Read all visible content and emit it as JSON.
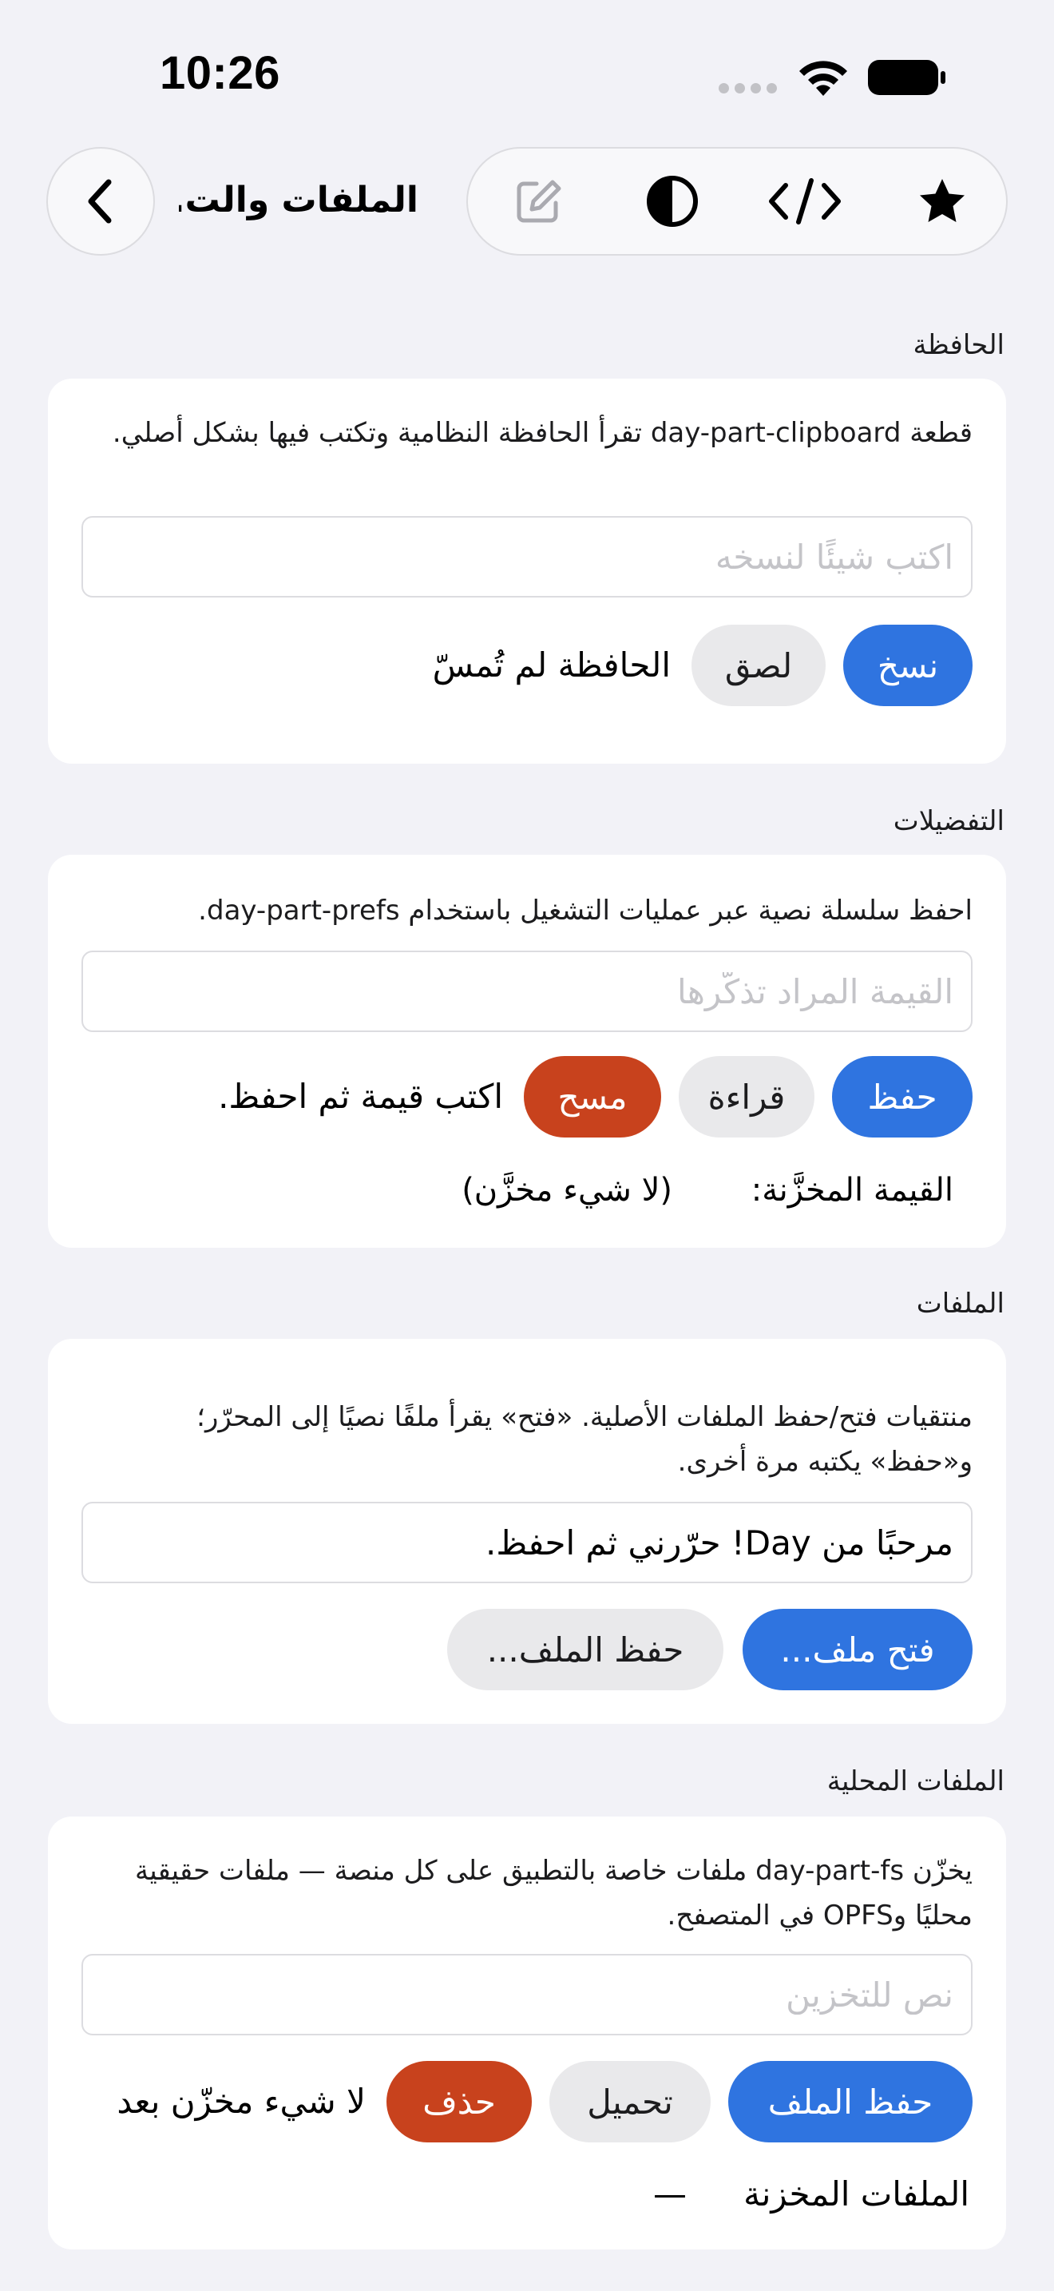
{
  "status_bar": {
    "time": "10:26"
  },
  "nav": {
    "title": "الملفات والت...",
    "icons": [
      "chevron-left-icon",
      "compose-icon",
      "contrast-icon",
      "code-icon",
      "star-icon"
    ]
  },
  "clipboard": {
    "section_label": "الحافظة",
    "description": "قطعة day-part-clipboard تقرأ الحافظة النظامية وتكتب فيها بشكل أصلي.",
    "input_placeholder": "اكتب شيئًا لنسخه",
    "copy_label": "نسخ",
    "paste_label": "لصق",
    "status": "الحافظة لم تُمسّ"
  },
  "prefs": {
    "section_label": "التفضيلات",
    "description": "احفظ سلسلة نصية عبر عمليات التشغيل باستخدام day-part-prefs.",
    "input_placeholder": "القيمة المراد تذكّرها",
    "save_label": "حفظ",
    "read_label": "قراءة",
    "clear_label": "مسح",
    "status": "اكتب قيمة ثم احفظ.",
    "stored_label": "القيمة المخزَّنة:",
    "stored_value": "(لا شيء مخزَّن)"
  },
  "files": {
    "section_label": "الملفات",
    "description": "منتقيات فتح/حفظ الملفات الأصلية. «فتح» يقرأ ملفًا نصيًا إلى المحرّر؛ و«حفظ» يكتبه مرة أخرى.",
    "editor_value": "مرحبًا من Day! حرّرني ثم احفظ.",
    "open_label": "فتح ملف...",
    "save_label": "حفظ الملف..."
  },
  "local_files": {
    "section_label": "الملفات المحلية",
    "description": "يخزّن day-part-fs ملفات خاصة بالتطبيق على كل منصة — ملفات حقيقية محليًا وOPFS في المتصفح.",
    "input_placeholder": "نص للتخزين",
    "save_label": "حفظ الملف",
    "load_label": "تحميل",
    "delete_label": "حذف",
    "status": "لا شيء مخزّن بعد",
    "stored_files_label": "الملفات المخزنة",
    "stored_files_value": "—"
  },
  "colors": {
    "accent_blue": "#2f74e0",
    "destructive_red": "#c8421d",
    "background": "#f2f2f7"
  }
}
